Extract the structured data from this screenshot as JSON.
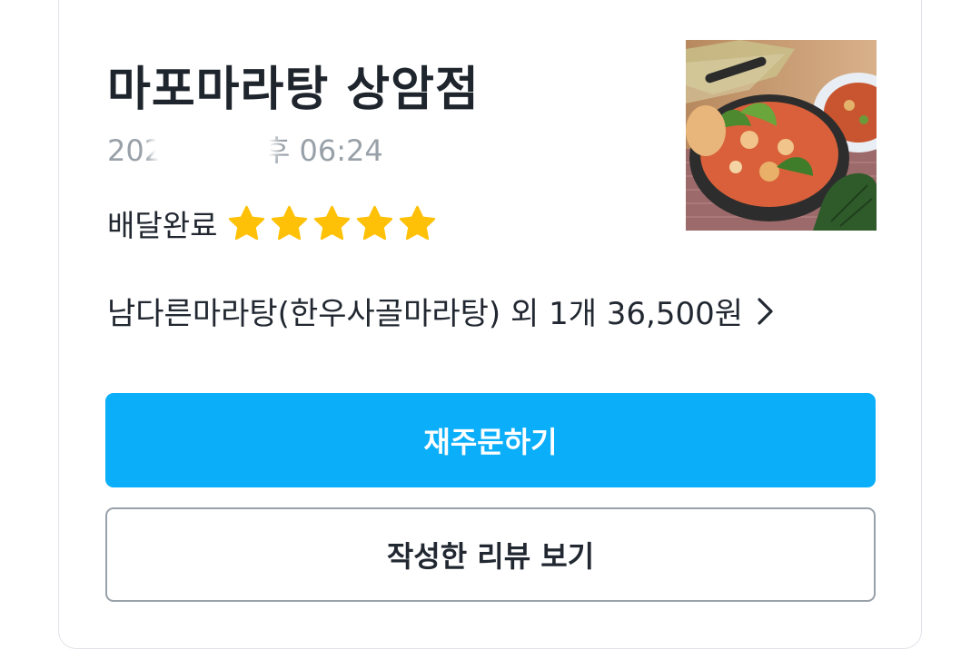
{
  "order": {
    "store_name": "마포마라탕 상암점",
    "date_text": "202 .03. 오후 06:24",
    "status": "배달완료",
    "rating": 5,
    "rating_max": 5,
    "star_color": "#FFC107",
    "summary": "남다른마라탕(한우사골마라탕) 외 1개 36,500원",
    "thumbnail_icon": "mala-soup-photo"
  },
  "buttons": {
    "reorder_label": "재주문하기",
    "review_label": "작성한 리뷰 보기",
    "reorder_color": "#0AAEF9"
  }
}
